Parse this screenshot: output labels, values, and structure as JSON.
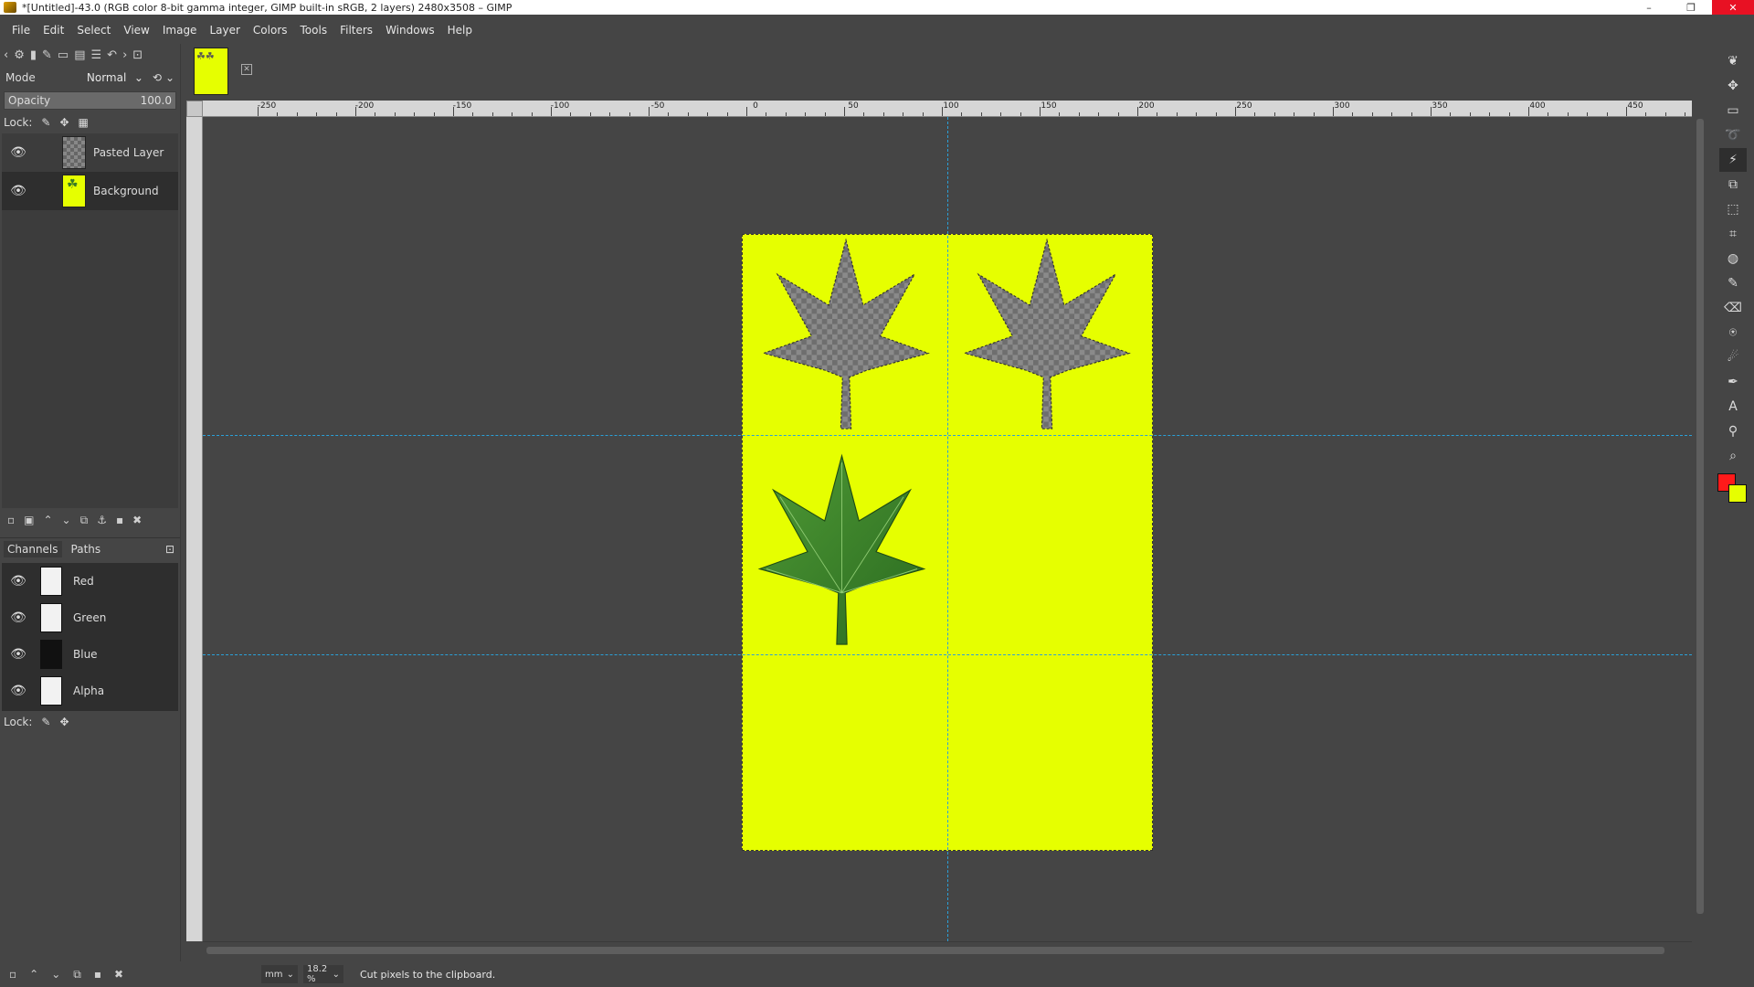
{
  "window": {
    "title": "*[Untitled]-43.0 (RGB color 8-bit gamma integer, GIMP built-in sRGB, 2 layers) 2480x3508 – GIMP",
    "minimize": "–",
    "maximize": "❐",
    "close": "✕"
  },
  "menu": [
    "File",
    "Edit",
    "Select",
    "View",
    "Image",
    "Layer",
    "Colors",
    "Tools",
    "Filters",
    "Windows",
    "Help"
  ],
  "layers_panel": {
    "mode_label": "Mode",
    "mode_value": "Normal",
    "opacity_label": "Opacity",
    "opacity_value": "100.0",
    "opacity_fraction": 1.0,
    "lock_label": "Lock:",
    "layers": [
      {
        "name": "Pasted Layer",
        "visible": true
      },
      {
        "name": "Background",
        "visible": true
      }
    ]
  },
  "channels_panel": {
    "tabs": [
      "Channels",
      "Paths"
    ],
    "channels": [
      {
        "name": "Red"
      },
      {
        "name": "Green"
      },
      {
        "name": "Blue"
      },
      {
        "name": "Alpha"
      }
    ],
    "lock_label": "Lock:"
  },
  "ruler": {
    "labels": [
      "-250",
      "-200",
      "-150",
      "-100",
      "-50",
      "0",
      "50",
      "100",
      "150",
      "200",
      "250",
      "300",
      "350",
      "400",
      "450"
    ]
  },
  "statusbar": {
    "unit": "mm",
    "zoom": "18.2 %",
    "message": "Cut pixels to the clipboard."
  },
  "colors": {
    "foreground": "#ff1a1a",
    "background": "#e6ff00",
    "image_fill": "#e6ff00"
  },
  "icons": {
    "eye": "eye-icon",
    "leaf": "leaf-icon"
  }
}
